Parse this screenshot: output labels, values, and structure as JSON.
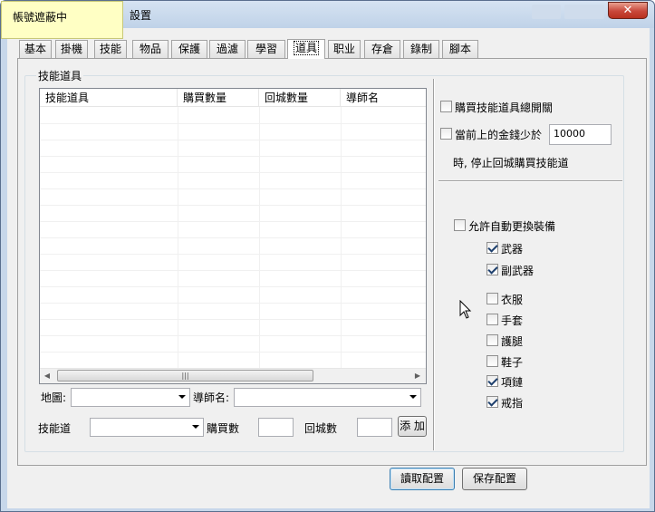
{
  "window": {
    "title": "設置",
    "close_label": "✕"
  },
  "overlay_tag": "帳號遮蔽中",
  "tabs": [
    {
      "label": "基本"
    },
    {
      "label": "掛機"
    },
    {
      "label": "技能"
    },
    {
      "label": "物品"
    },
    {
      "label": "保護"
    },
    {
      "label": "過濾"
    },
    {
      "label": "學習"
    },
    {
      "label": "道具",
      "active": true
    },
    {
      "label": "职业"
    },
    {
      "label": "存倉"
    },
    {
      "label": "錄制"
    },
    {
      "label": "腳本"
    }
  ],
  "group_title": "技能道具",
  "list": {
    "columns": [
      "技能道具",
      "購買數量",
      "回城數量",
      "導師名"
    ],
    "rows": []
  },
  "form": {
    "map_label": "地圖:",
    "map_value": "",
    "mentor_label": "導師名:",
    "mentor_value": "",
    "skill_item_label": "技能道",
    "skill_item_value": "",
    "buy_qty_label": "購買數",
    "buy_qty_value": "",
    "return_qty_label": "回城數",
    "return_qty_value": "",
    "add_button": "添 加"
  },
  "options": {
    "master_switch": {
      "label": "購買技能道具總開關",
      "checked": false
    },
    "gold_below": {
      "label": "當前上的金錢少於",
      "checked": false,
      "value": "10000"
    },
    "gold_note": "時, 停止回城購買技能道"
  },
  "auto_equip": {
    "label": "允許自動更換裝備",
    "checked": false,
    "items": [
      {
        "label": "武器",
        "checked": true
      },
      {
        "label": "副武器",
        "checked": true
      },
      {
        "label": "衣服",
        "checked": false
      },
      {
        "label": "手套",
        "checked": false
      },
      {
        "label": "護腿",
        "checked": false
      },
      {
        "label": "鞋子",
        "checked": false
      },
      {
        "label": "項鏈",
        "checked": true
      },
      {
        "label": "戒指",
        "checked": true
      }
    ]
  },
  "footer": {
    "read_button": "讀取配置",
    "save_button": "保存配置"
  },
  "icons": {
    "cursor": "mouse-pointer-icon",
    "scroll_left": "arrow-left-icon",
    "scroll_right": "arrow-right-icon"
  }
}
